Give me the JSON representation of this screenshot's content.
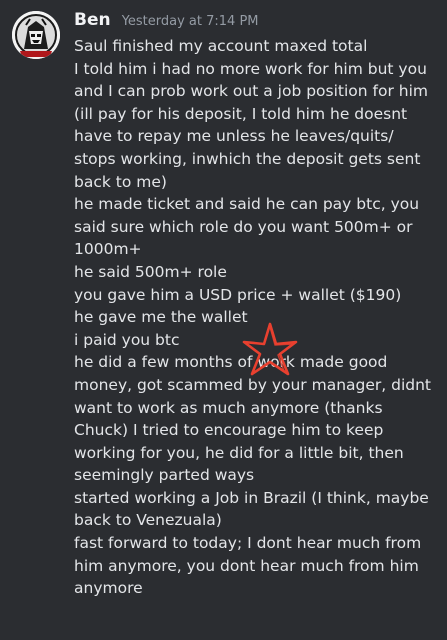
{
  "message": {
    "author": "Ben",
    "timestamp": "Yesterday at 7:14 PM",
    "lines": [
      "Saul finished my account maxed total",
      "I told him i had no more work for him but you",
      "and I can prob work out a job position for him",
      "(ill pay for his deposit, I told him he doesnt",
      "have to repay me unless he leaves/quits/",
      "stops working, inwhich the deposit  gets sent",
      "back to me)",
      "he made ticket and said he can pay btc, you",
      "said sure which role do you want 500m+ or",
      "1000m+",
      "he said 500m+ role",
      "you gave him a USD price + wallet ($190)",
      "he gave me the wallet",
      "i paid you btc",
      "he did a few months of work made good",
      "money, got scammed by your manager, didnt",
      "want to work as much anymore (thanks",
      "Chuck) I tried to encourage him to keep",
      "working for you, he did for a little bit, then",
      "seemingly parted ways",
      "started working a Job in Brazil (I think, maybe",
      "back to Venezuala)",
      "fast forward to today; I dont hear much from",
      "him anymore, you dont hear much from him",
      "anymore"
    ]
  },
  "colors": {
    "background": "#2b2d31",
    "username": "#f2f3f5",
    "timestamp": "#949ba4",
    "text": "#e3e5e8",
    "annotation": "#e8402f"
  },
  "icons": {
    "avatar": "user-avatar",
    "annotation": "hand-drawn-red-star"
  }
}
